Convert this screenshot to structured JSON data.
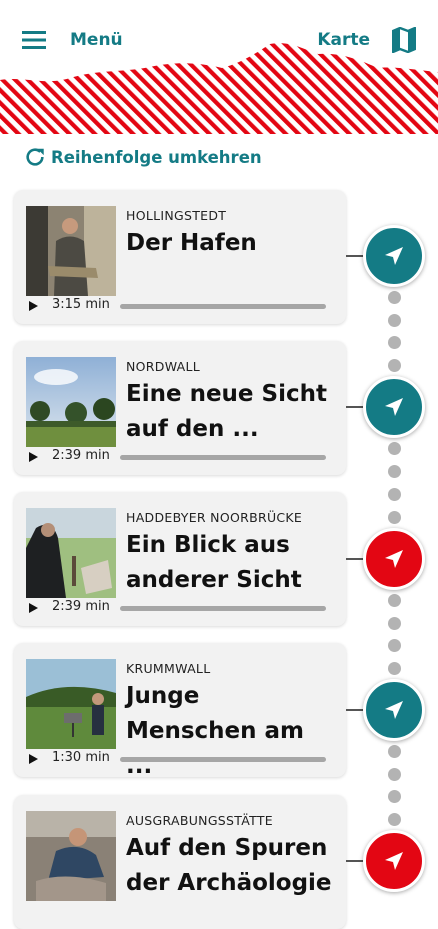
{
  "header": {
    "menu_label": "Menü",
    "map_label": "Karte",
    "accent_color": "#147b85",
    "stripe_color": "#e30613"
  },
  "reverse_label": "Reihenfolge umkehren",
  "stations": [
    {
      "place": "HOLLINGSTEDT",
      "title": "Der Hafen",
      "duration": "3:15 min",
      "visited": false
    },
    {
      "place": "NORDWALL",
      "title": "Eine neue Sicht auf den ...",
      "duration": "2:39 min",
      "visited": false
    },
    {
      "place": "HADDEBYER NOORBRÜCKE",
      "title": "Ein Blick aus anderer Sicht",
      "duration": "2:39 min",
      "visited": true
    },
    {
      "place": "KRUMMWALL",
      "title": "Junge Menschen am ...",
      "duration": "1:30 min",
      "visited": false
    },
    {
      "place": "AUSGRABUNGSSTÄTTE",
      "title": "Auf den Spuren der Archäologie",
      "duration": "",
      "visited": true
    }
  ],
  "status_colors": {
    "default": "#147b85",
    "highlight": "#e30613"
  },
  "icons": [
    "hamburger-icon",
    "map-icon",
    "refresh-icon",
    "play-icon",
    "navigation-arrow-icon"
  ]
}
